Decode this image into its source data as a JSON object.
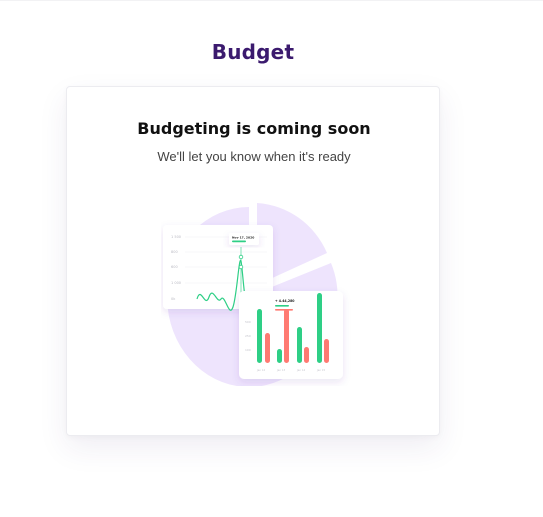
{
  "page": {
    "title": "Budget"
  },
  "card": {
    "heading": "Budgeting is coming soon",
    "subheading": "We'll let you know when it's ready"
  },
  "colors": {
    "title": "#3b1a6e",
    "pie": "#eee4fd",
    "green": "#2ecf86",
    "red": "#ff7a72"
  },
  "illustration": {
    "line_tooltip_date": "Nov 17, 2020",
    "bar_tooltip_value": "+ 4.44,280"
  }
}
